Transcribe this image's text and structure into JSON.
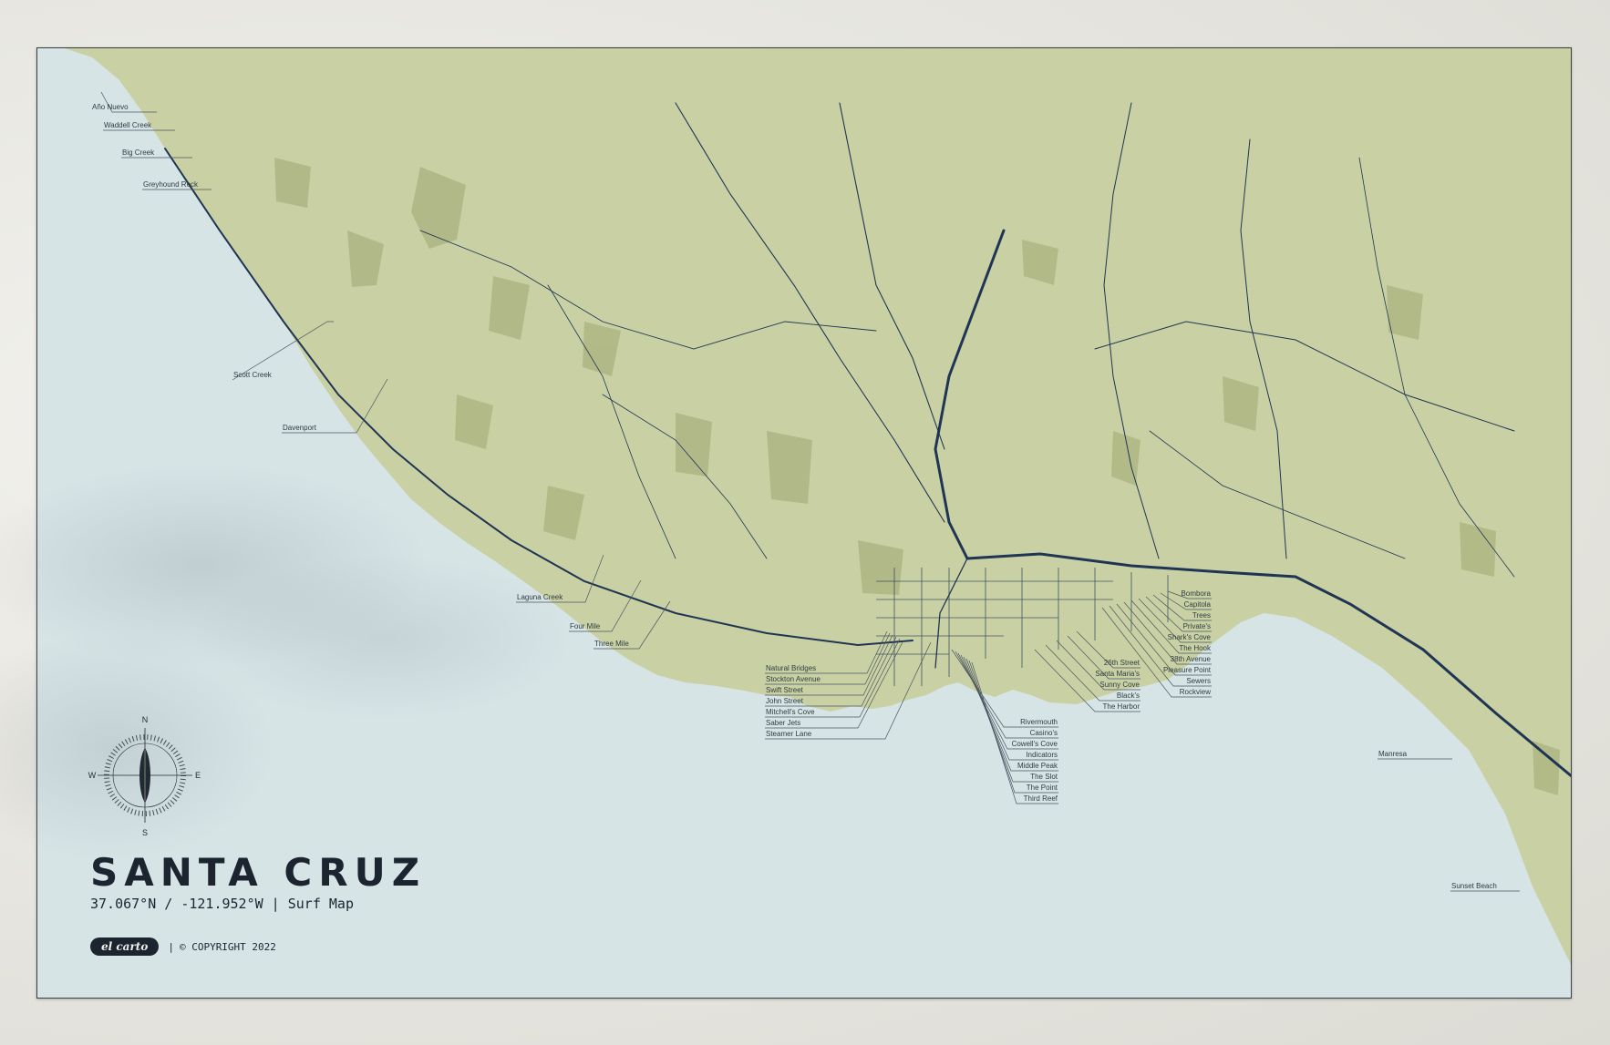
{
  "poster": {
    "title": "SANTA CRUZ",
    "coords": "37.067°N / -121.952°W | Surf Map",
    "brand": "el carto",
    "separator": "|",
    "copyright": "© COPYRIGHT 2022"
  },
  "compass": {
    "n": "N",
    "s": "S",
    "e": "E",
    "w": "W"
  },
  "colors": {
    "ocean": "#d6e4e6",
    "land": "#c9d1a4",
    "land_dark": "#a9b27f",
    "road": "#1f3553",
    "text": "#1c2430"
  },
  "surf_spots": {
    "north_coast": [
      "Año Nuevo",
      "Waddell Creek",
      "Big Creek",
      "Greyhound Rock",
      "Scott Creek",
      "Davenport",
      "Laguna Creek",
      "Four Mile",
      "Three Mile"
    ],
    "westside": [
      "Natural Bridges",
      "Stockton Avenue",
      "Swift Street",
      "John Street",
      "Mitchell's Cove",
      "Saber Jets",
      "Steamer Lane"
    ],
    "main_beach": [
      "Rivermouth",
      "Casino's",
      "Cowell's Cove",
      "Indicators",
      "Middle Peak",
      "The Slot",
      "The Point",
      "Third Reef"
    ],
    "harbor_east": [
      "26th Street",
      "Santa Maria's",
      "Sunny Cove",
      "Black's",
      "The Harbor"
    ],
    "pleasure_point": [
      "Bombora",
      "Capitola",
      "Trees",
      "Private's",
      "Shark's Cove",
      "The Hook",
      "38th Avenue",
      "Pleasure Point",
      "Sewers",
      "Rockview"
    ],
    "south": [
      "Manresa",
      "Sunset Beach"
    ]
  }
}
